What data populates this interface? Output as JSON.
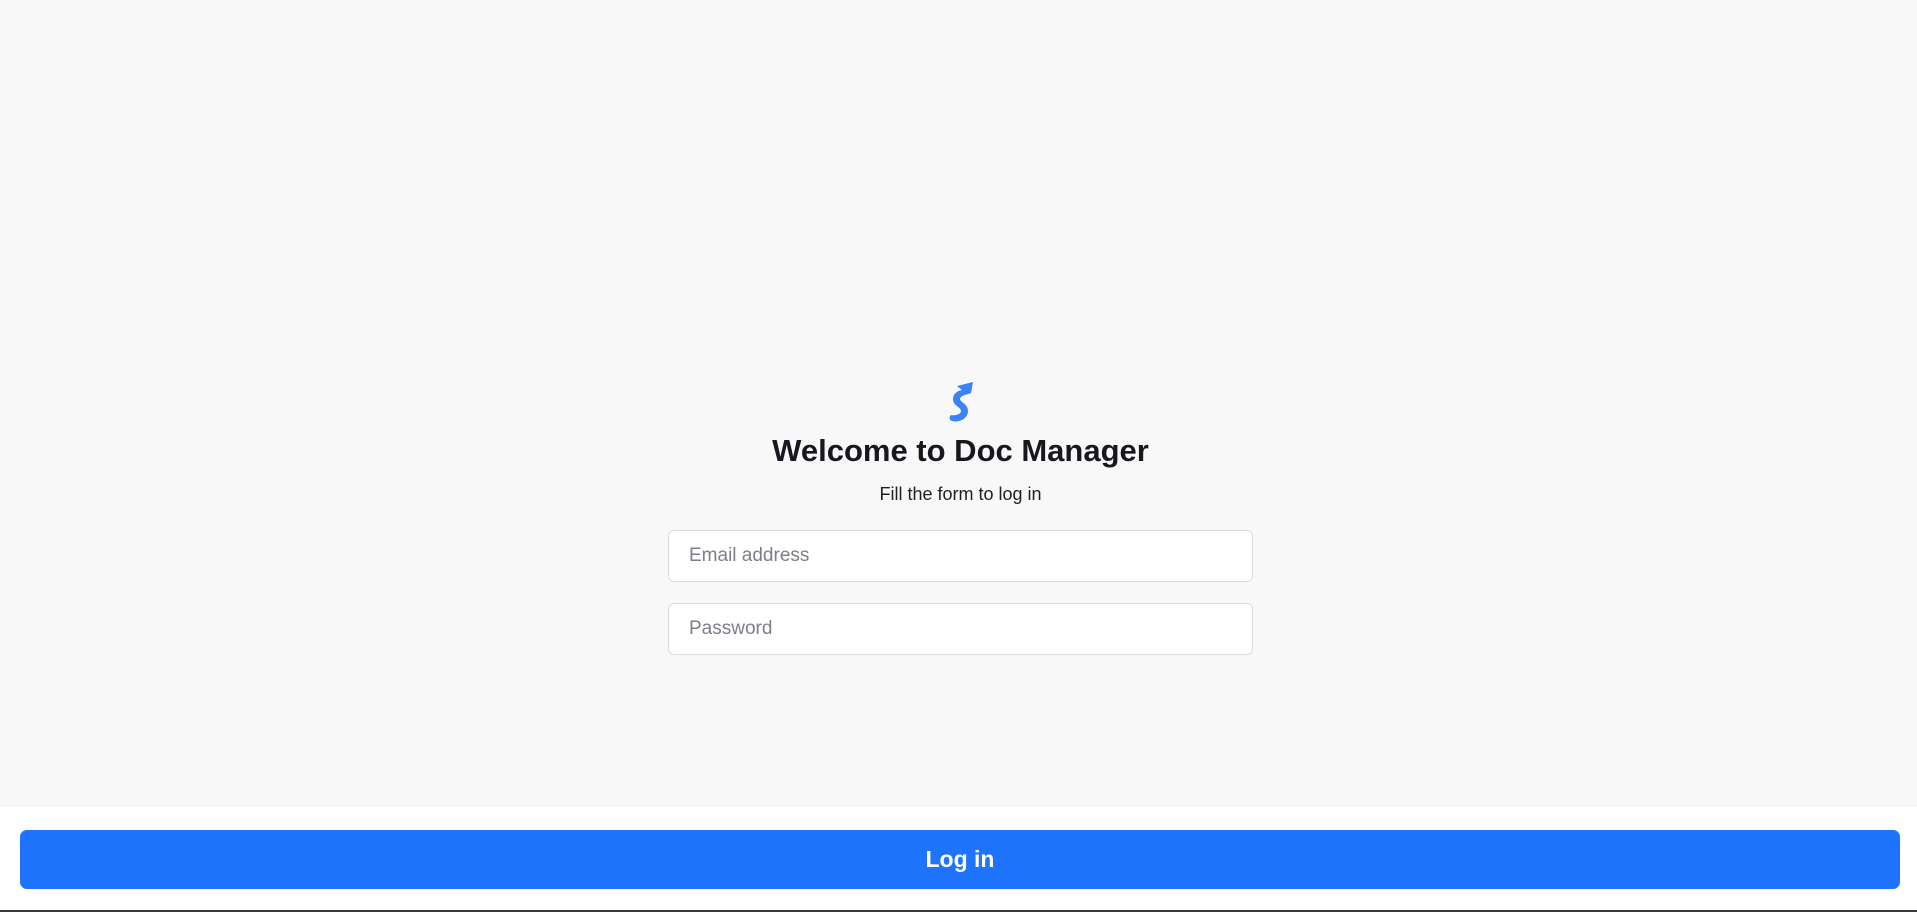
{
  "app": {
    "logo_icon": "stripe-s-logo-icon",
    "title": "Welcome to Doc Manager",
    "subtitle": "Fill the form to log in"
  },
  "form": {
    "email": {
      "placeholder": "Email address",
      "value": ""
    },
    "password": {
      "placeholder": "Password",
      "value": ""
    }
  },
  "footer": {
    "login_label": "Log in"
  },
  "colors": {
    "accent": "#1e74fd",
    "logo": "#3b82f6",
    "background": "#f8f8f9"
  }
}
